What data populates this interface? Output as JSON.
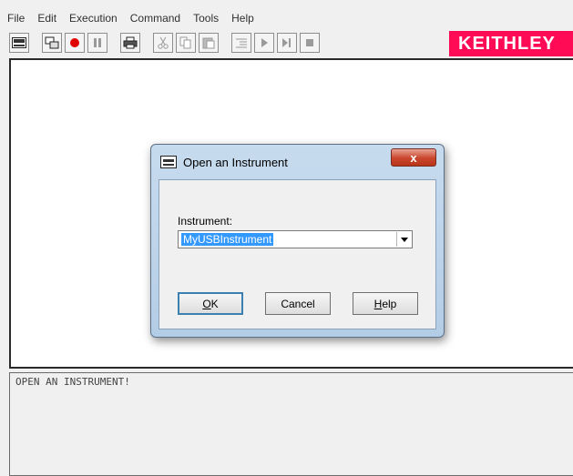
{
  "menu": [
    "File",
    "Edit",
    "Execution",
    "Command",
    "Tools",
    "Help"
  ],
  "brand": {
    "logo_text": "KEITHLEY",
    "color": "#ff0a54"
  },
  "toolbar": {
    "icons": [
      "instrument-icon",
      "connect-icon",
      "record-icon",
      "pause-icon",
      "print-icon",
      "cut-icon",
      "copy-icon",
      "paste-icon",
      "indent-icon",
      "play-icon",
      "step-icon",
      "stop-icon"
    ]
  },
  "output": {
    "text": "OPEN AN INSTRUMENT!"
  },
  "dialog": {
    "title": "Open an Instrument",
    "close_label": "x",
    "field_label": "Instrument:",
    "selected": "MyUSBInstrument",
    "ok_label_u": "O",
    "ok_label_rest": "K",
    "cancel_label": "Cancel",
    "help_label_u": "H",
    "help_label_rest": "elp"
  }
}
